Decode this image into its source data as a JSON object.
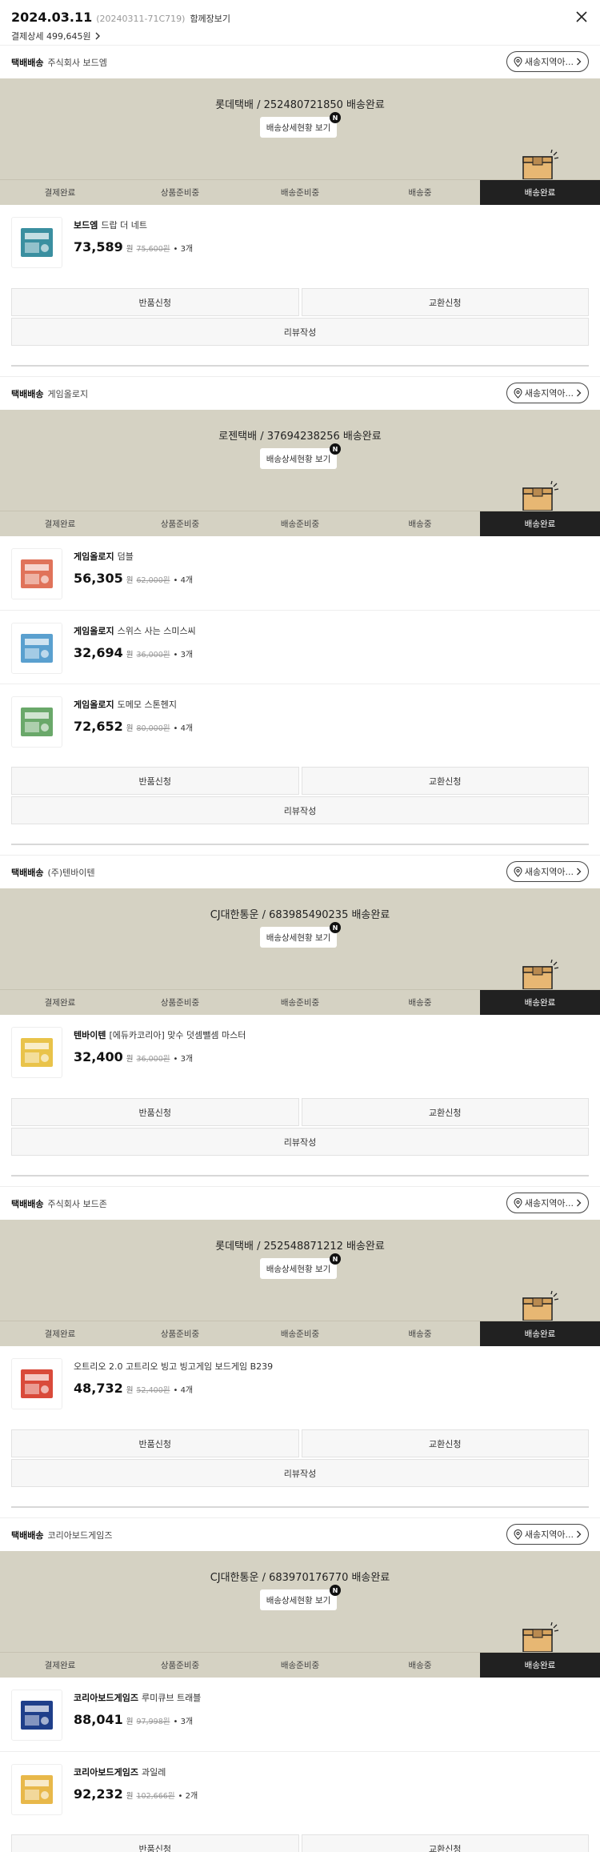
{
  "header": {
    "date": "2024.03.11",
    "order_no": "(20240311-71C719)",
    "receipt_link": "함께장보기",
    "payment_label": "결제상세 499,645원"
  },
  "common": {
    "region_button": "새송지역아...",
    "detail_button": "배송상세현황 보기",
    "new_badge": "N",
    "steps": [
      "결제완료",
      "상품준비중",
      "배송준비중",
      "배송중",
      "배송완료"
    ],
    "return_button": "반품신청",
    "exchange_button": "교환신청",
    "review_button": "리뷰작성",
    "won": "원"
  },
  "shipments": [
    {
      "type": "택배배송",
      "seller": "주식회사 보드엠",
      "tracking": "롯데택배 / 252480721850 배송완료",
      "products": [
        {
          "brand": "보드엠",
          "name": "드랍 더 네트",
          "price": "73,589",
          "original": "75,600원",
          "qty": "3개",
          "thumb_color": "#3a8fa0"
        }
      ]
    },
    {
      "type": "택배배송",
      "seller": "게임올로지",
      "tracking": "로젠택배 / 37694238256 배송완료",
      "products": [
        {
          "brand": "게임올로지",
          "name": "덤블",
          "price": "56,305",
          "original": "62,000원",
          "qty": "4개",
          "thumb_color": "#e0735a"
        },
        {
          "brand": "게임올로지",
          "name": "스위스 사는 스미스씨",
          "price": "32,694",
          "original": "36,000원",
          "qty": "3개",
          "thumb_color": "#5aa0cf"
        },
        {
          "brand": "게임올로지",
          "name": "도메모 스톤헨지",
          "price": "72,652",
          "original": "80,000원",
          "qty": "4개",
          "thumb_color": "#6aa86a"
        }
      ]
    },
    {
      "type": "택배배송",
      "seller": "(주)텐바이텐",
      "tracking": "CJ대한통운 / 683985490235 배송완료",
      "products": [
        {
          "brand": "텐바이텐",
          "name": "[에듀카코리아] 맞수 덧셈뺄셈 마스터",
          "price": "32,400",
          "original": "36,000원",
          "qty": "3개",
          "thumb_color": "#e9c34a"
        }
      ]
    },
    {
      "type": "택배배송",
      "seller": "주식회사 보드존",
      "tracking": "롯데택배 / 252548871212 배송완료",
      "products": [
        {
          "brand": "",
          "name": "오트리오 2.0 고트리오 빙고 빙고게임 보드게임 B239",
          "price": "48,732",
          "original": "52,400원",
          "qty": "4개",
          "thumb_color": "#d94a3a"
        }
      ]
    },
    {
      "type": "택배배송",
      "seller": "코리아보드게임즈",
      "tracking": "CJ대한통운 / 683970176770 배송완료",
      "products": [
        {
          "brand": "코리아보드게임즈",
          "name": "루미큐브 트래블",
          "price": "88,041",
          "original": "97,998원",
          "qty": "3개",
          "thumb_color": "#1f3f8a"
        },
        {
          "brand": "코리아보드게임즈",
          "name": "과일레",
          "price": "92,232",
          "original": "102,666원",
          "qty": "2개",
          "thumb_color": "#e8b84a"
        }
      ]
    }
  ]
}
